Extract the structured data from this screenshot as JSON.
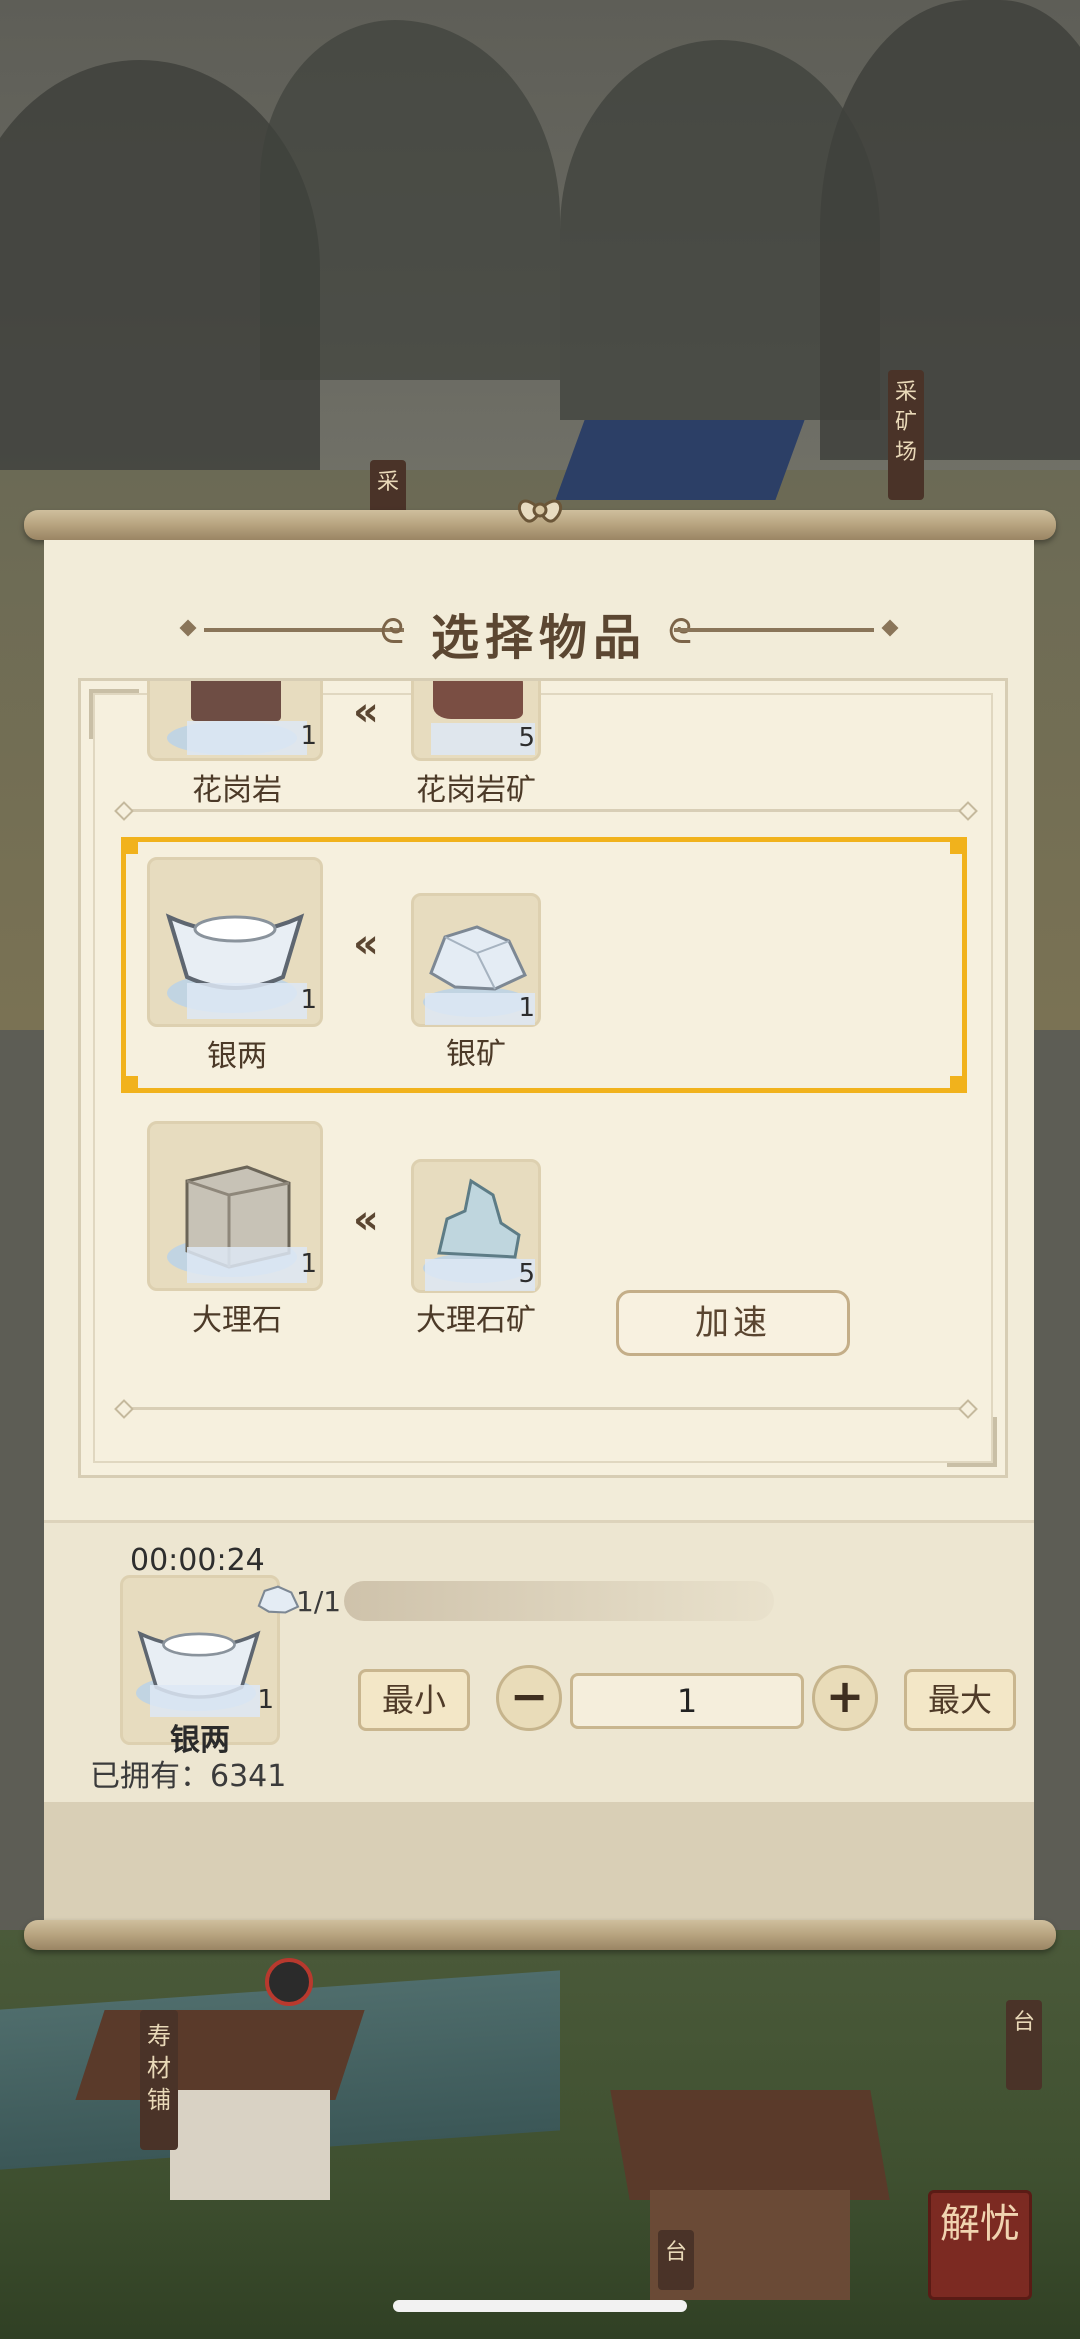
{
  "background": {
    "shop_sign": "寿材铺",
    "left_sign": "采",
    "right_sign": "采矿场",
    "right_tower_sign": "台",
    "bottom_sign": "台",
    "seal_text": "解忧"
  },
  "dialog": {
    "title": "选择物品",
    "recipes": [
      {
        "product": {
          "name": "花岗岩",
          "count": "1",
          "icon": "granite-block-icon"
        },
        "material": {
          "name": "花岗岩矿",
          "count": "5",
          "icon": "granite-ore-icon"
        }
      },
      {
        "product": {
          "name": "银两",
          "count": "1",
          "icon": "silver-ingot-icon"
        },
        "material": {
          "name": "银矿",
          "count": "1",
          "icon": "silver-ore-icon"
        }
      },
      {
        "product": {
          "name": "大理石",
          "count": "1",
          "icon": "marble-block-icon"
        },
        "material": {
          "name": "大理石矿",
          "count": "5",
          "icon": "marble-ore-icon"
        }
      }
    ],
    "selected_index": 1
  },
  "production": {
    "timer": "00:00:24",
    "item_name": "银两",
    "item_count": "1",
    "owned_label": "已拥有：6341",
    "requirement": "1/1",
    "min_label": "最小",
    "max_label": "最大",
    "minus_label": "−",
    "plus_label": "+",
    "quantity": "1",
    "speed_up_label": "加速"
  },
  "colors": {
    "selection": "#f1b21c",
    "panel": "#f2ecd9",
    "title": "#5b4631"
  }
}
